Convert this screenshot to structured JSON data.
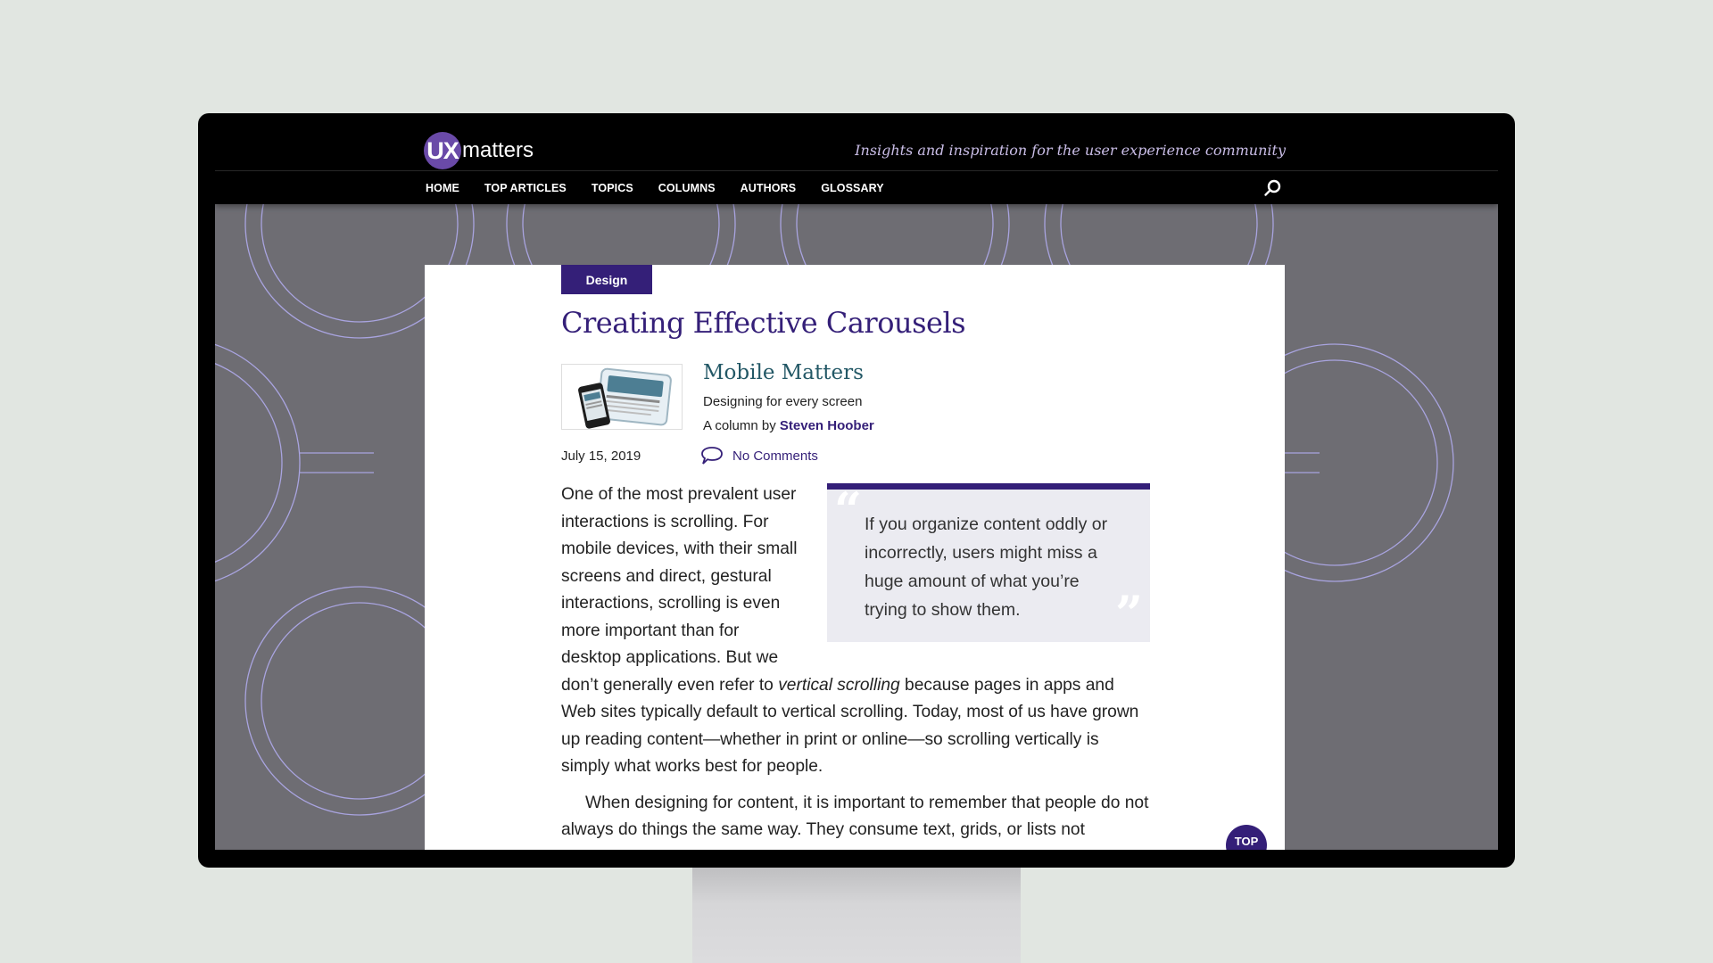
{
  "site": {
    "logo_badge": "UX",
    "logo_text": "matters",
    "tagline": "Insights and inspiration for the user experience community"
  },
  "nav": {
    "items": [
      {
        "label": "HOME"
      },
      {
        "label": "TOP ARTICLES"
      },
      {
        "label": "TOPICS"
      },
      {
        "label": "COLUMNS"
      },
      {
        "label": "AUTHORS"
      },
      {
        "label": "GLOSSARY"
      }
    ],
    "search_icon": "search-icon"
  },
  "article": {
    "category": "Design",
    "title": "Creating Effective Carousels",
    "column": {
      "name": "Mobile Matters",
      "subtitle": "Designing for every screen",
      "by_prefix": "A column by ",
      "author": "Steven Hoober"
    },
    "date": "July 15, 2019",
    "comments": "No Comments",
    "pullquote": "If you organize content oddly or incorrectly, users might miss a huge amount of what you’re trying to show them.",
    "paragraph1": {
      "before_em": "One of the most prevalent user interactions is scrolling. For mobile devices, with their small screens and direct, gestural interactions, scrolling is even more important than for desktop applications. But we don’t generally even refer to ",
      "em": "vertical scrolling",
      "after_em": " because pages in apps and Web sites typically default to vertical scrolling. Today, most of us have grown up reading content—whether in print or online—so scrolling vertically is simply what works best for people."
    },
    "paragraph2": "When designing for content, it is important to remember that people do not always do things the same way. They consume text, grids, or lists not"
  },
  "back_to_top": "TOP",
  "colors": {
    "brand_purple": "#341f78",
    "logo_purple": "#6a4aa8",
    "column_teal": "#235866",
    "page_background": "#6e6d73",
    "pattern_line": "#a9a4e0"
  }
}
